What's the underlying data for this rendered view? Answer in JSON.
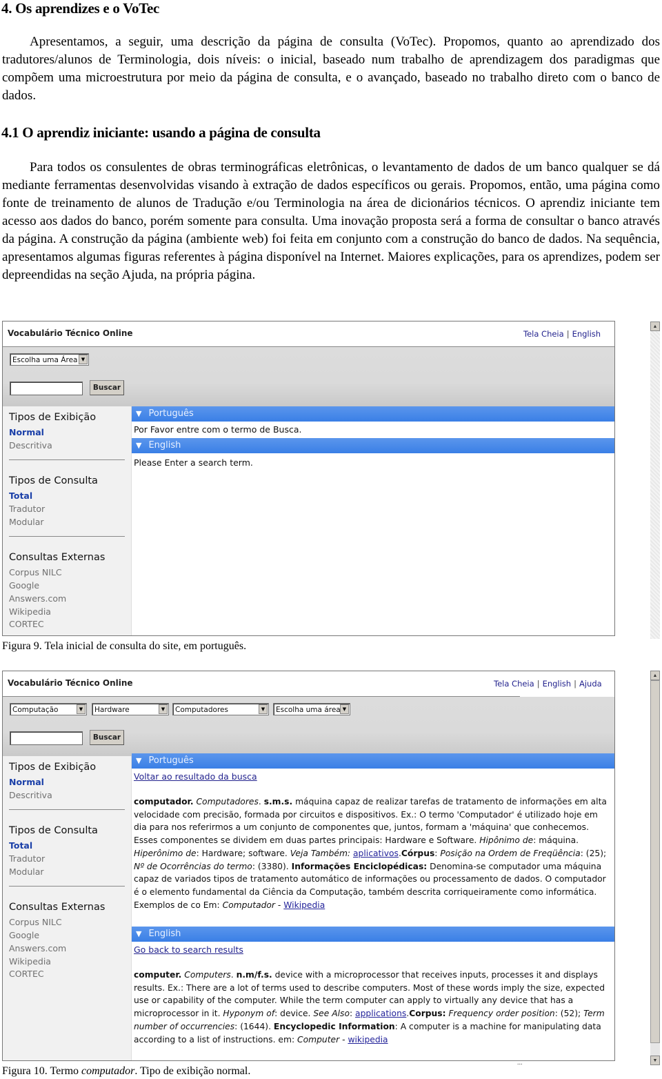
{
  "section": {
    "heading": "4. Os aprendizes e o VoTec",
    "intro": "Apresentamos, a seguir, uma descrição da página de consulta (VoTec). Propomos, quanto ao aprendizado dos tradutores/alunos de Terminologia, dois níveis: o inicial, baseado num trabalho de aprendizagem dos paradigmas que compõem uma microestrutura por meio da página de consulta, e o avançado, baseado no trabalho direto com o banco de dados.",
    "subheading": "4.1 O aprendiz iniciante: usando a página de consulta",
    "body": "Para todos os consulentes de obras terminográficas eletrônicas, o levantamento de dados de um banco qualquer se dá mediante ferramentas desenvolvidas visando à extração de dados específicos ou gerais. Propomos, então, uma página como fonte de treinamento de alunos de Tradução e/ou Terminologia na área de dicionários técnicos. O aprendiz iniciante tem acesso aos dados do banco, porém somente para consulta. Uma inovação proposta será a forma de consultar o banco através da página. A construção da página (ambiente web) foi feita em conjunto com a construção do banco de dados. Na sequência, apresentamos algumas figuras referentes à página disponível na Internet. Maiores explicações, para os aprendizes, podem ser depreendidas na seção Ajuda, na própria página."
  },
  "figure9": {
    "caption": "Figura 9. Tela inicial de consulta do site, em português.",
    "app_title": "Vocabulário Técnico Online",
    "links": [
      "Tela Cheia",
      "English"
    ],
    "area_select": "Escolha uma Área",
    "search_value": "",
    "search_button": "Buscar",
    "sidebar": {
      "display_heading": "Tipos de Exibição",
      "display_items": [
        {
          "label": "Normal",
          "active": true
        },
        {
          "label": "Descritiva",
          "active": false
        }
      ],
      "query_heading": "Tipos de Consulta",
      "query_items": [
        {
          "label": "Total",
          "active": true
        },
        {
          "label": "Tradutor",
          "active": false
        },
        {
          "label": "Modular",
          "active": false
        }
      ],
      "external_heading": "Consultas Externas",
      "external_items": [
        "Corpus NILC",
        "Google",
        "Answers.com",
        "Wikipedia",
        "CORTEC"
      ]
    },
    "pt_header": "Português",
    "pt_message": "Por Favor entre com o termo de Busca.",
    "en_header": "English",
    "en_message": "Please Enter a search term."
  },
  "figure10": {
    "caption_pre": "Figura 10. Termo ",
    "caption_term": "computador",
    "caption_post": ". Tipo de exibição normal.",
    "app_title": "Vocabulário Técnico Online",
    "links": [
      "Tela Cheia",
      "English",
      "Ajuda"
    ],
    "selects": [
      "Computação",
      "Hardware",
      "Computadores",
      "Escolha uma área"
    ],
    "search_value": "",
    "search_button": "Buscar",
    "sidebar": {
      "display_heading": "Tipos de Exibição",
      "display_items": [
        {
          "label": "Normal",
          "active": true
        },
        {
          "label": "Descritiva",
          "active": false
        }
      ],
      "query_heading": "Tipos de Consulta",
      "query_items": [
        {
          "label": "Total",
          "active": true
        },
        {
          "label": "Tradutor",
          "active": false
        },
        {
          "label": "Modular",
          "active": false
        }
      ],
      "external_heading": "Consultas Externas",
      "external_items": [
        "Corpus NILC",
        "Google",
        "Answers.com",
        "Wikipedia",
        "CORTEC"
      ]
    },
    "pt_header": "Português",
    "pt_back_link": "Voltar ao resultado da busca",
    "pt_entry": {
      "term": "computador.",
      "plural": "Computadores",
      "gram": "s.m.s.",
      "definition": "máquina capaz de realizar tarefas de tratamento de informações em alta velocidade com precisão, formada por circuitos e dispositivos. Ex.: O termo 'Computador' é utilizado hoje em dia para nos referirmos a um conjunto de componentes que, juntos, formam a 'máquina' que conhecemos. Esses componentes se dividem em duas partes principais: Hardware e Software.",
      "hyponym_label": "Hipônimo de",
      "hyponym_value": "máquina.",
      "hypernym_label": "Hiperônimo de",
      "hypernym_value": "Hardware; software.",
      "see_also_label": "Veja Também:",
      "see_also_link": "aplicativos",
      "corpus_label": "Córpus",
      "freq_label": "Posição na Ordem de Freqüência",
      "freq_value": "(25);",
      "occ_label": "Nº de Ocorrências do termo",
      "occ_value": "(3380).",
      "enc_label": "Informações Enciclopédicas:",
      "enc_value": "Denomina-se computador uma máquina capaz de variados tipos de tratamento automático de informações ou processamento de dados. O computador é o elemento fundamental da Ciência da Computação, também descrita corriqueiramente como informática. Exemplos de co Em:",
      "source_title": "Computador",
      "source_link": "Wikipedia"
    },
    "en_header": "English",
    "en_back_link": "Go back to search results",
    "en_entry": {
      "term": "computer.",
      "plural": "Computers",
      "gram": "n.m/f.s.",
      "definition": "device with a microprocessor that receives inputs, processes it and displays results. Ex.: There are a lot of terms used to describe computers. Most of these words imply the size, expected use or capability of the computer. While the term computer can apply to virtually any device that has a microprocessor in it.",
      "hyponym_label": "Hyponym of",
      "hyponym_value": "device.",
      "see_also_label": "See Also",
      "see_also_link": "applications",
      "corpus_label": "Corpus:",
      "freq_label": "Frequency order position",
      "freq_value": "(52);",
      "occ_label": "Term number of occurrencies",
      "occ_value": "(1644).",
      "enc_label": "Encyclopedic Information",
      "enc_value": "A computer is a machine for manipulating data according to a list of instructions. em:",
      "source_title": "Computer",
      "source_link": "wikipedia"
    },
    "footer_dots": "..."
  }
}
